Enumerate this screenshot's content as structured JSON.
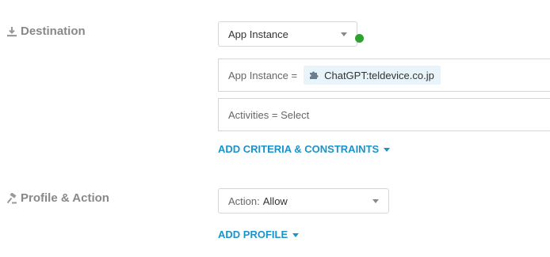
{
  "destination": {
    "label": "Destination",
    "icon": "download-icon",
    "type_select": {
      "value": "App Instance"
    },
    "status_color": "#2ea12e",
    "app_instance_field": {
      "prefix": "App Instance =",
      "chip_icon": "puzzle-icon",
      "chip_value": "ChatGPT:teldevice.co.jp"
    },
    "activities_field": {
      "text": "Activities = Select"
    },
    "add_criteria_link": "ADD CRITERIA & CONSTRAINTS"
  },
  "profile": {
    "label": "Profile & Action",
    "icon": "gavel-icon",
    "action_select": {
      "prefix": "Action:",
      "value": "Allow"
    },
    "add_profile_link": "ADD PROFILE"
  },
  "colors": {
    "link": "#1a93c9",
    "label": "#888888",
    "chip_bg": "#e8f3fa"
  }
}
